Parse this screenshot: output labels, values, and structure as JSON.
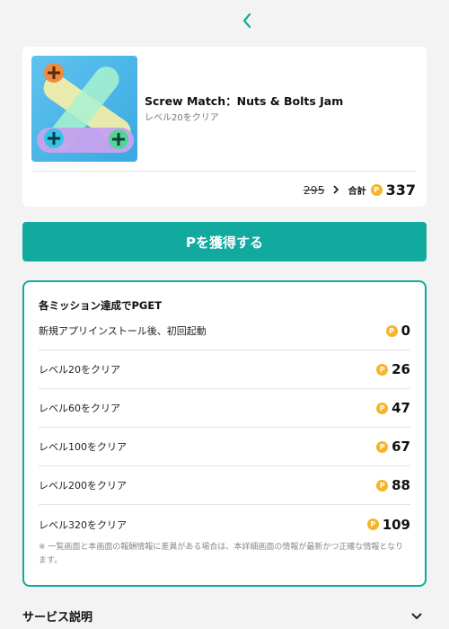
{
  "header": {
    "back_icon": "chevron-left-icon"
  },
  "app": {
    "title": "Screw Match：Nuts & Bolts Jam",
    "subtitle": "レベル20をクリア",
    "old_price": "295",
    "total_label": "合計",
    "total_value": "337"
  },
  "cta": {
    "label": "Pを獲得する"
  },
  "missions": {
    "title": "各ミッション達成でPGET",
    "items": [
      {
        "label": "新規アプリインストール後、初回起動",
        "value": "0"
      },
      {
        "label": "レベル20をクリア",
        "value": "26"
      },
      {
        "label": "レベル60をクリア",
        "value": "47"
      },
      {
        "label": "レベル100をクリア",
        "value": "67"
      },
      {
        "label": "レベル200をクリア",
        "value": "88"
      },
      {
        "label": "レベル320をクリア",
        "value": "109"
      }
    ],
    "note": "※ 一覧画面と本画面の報酬情報に差異がある場合は、本詳細画面の情報が最新かつ正確な情報となります。"
  },
  "coin_symbol": "P",
  "service": {
    "title": "サービス説明"
  },
  "colors": {
    "accent": "#12a99e",
    "coin": "#f5b429",
    "background": "#f3f3f3"
  }
}
